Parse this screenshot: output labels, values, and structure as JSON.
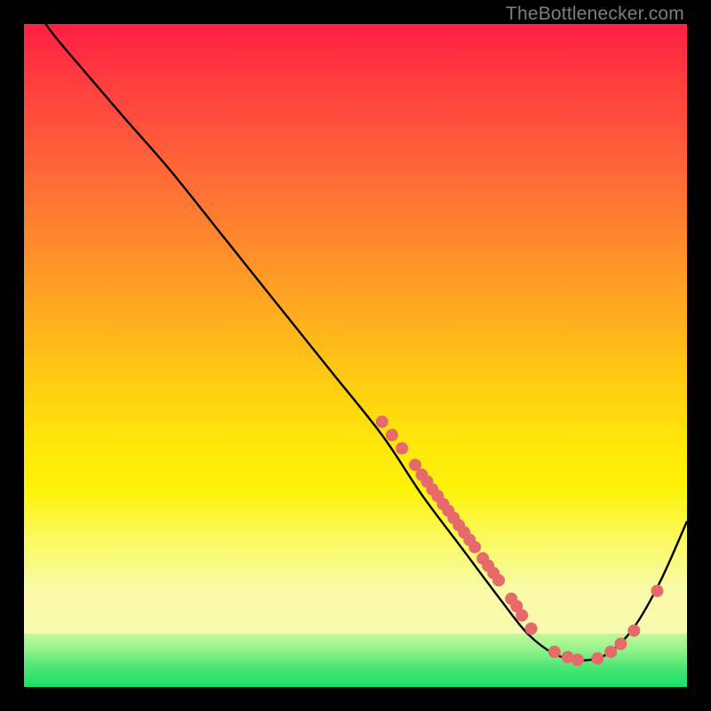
{
  "attribution": "TheBottlenecker.com",
  "chart_data": {
    "type": "line",
    "title": "",
    "xlabel": "",
    "ylabel": "",
    "xlim": [
      0,
      100
    ],
    "ylim": [
      0,
      100
    ],
    "grid": false,
    "series": [
      {
        "name": "curve",
        "x": [
          0,
          4,
          9,
          15,
          22,
          30,
          38,
          46,
          54,
          60,
          66,
          72,
          76,
          80,
          84,
          88,
          92,
          96,
          100
        ],
        "y": [
          105,
          99,
          93,
          86,
          78,
          68,
          58,
          48,
          38,
          29,
          21,
          13,
          8,
          5,
          4,
          5,
          9,
          16,
          25
        ]
      }
    ],
    "markers": [
      {
        "x": 54.0,
        "y": 40.0
      },
      {
        "x": 55.5,
        "y": 38.0
      },
      {
        "x": 57.0,
        "y": 36.0
      },
      {
        "x": 59.0,
        "y": 33.5
      },
      {
        "x": 60.0,
        "y": 32.0
      },
      {
        "x": 60.8,
        "y": 31.0
      },
      {
        "x": 61.6,
        "y": 29.8
      },
      {
        "x": 62.4,
        "y": 28.8
      },
      {
        "x": 63.2,
        "y": 27.6
      },
      {
        "x": 64.0,
        "y": 26.6
      },
      {
        "x": 64.8,
        "y": 25.5
      },
      {
        "x": 65.6,
        "y": 24.4
      },
      {
        "x": 66.4,
        "y": 23.3
      },
      {
        "x": 67.2,
        "y": 22.2
      },
      {
        "x": 68.0,
        "y": 21.1
      },
      {
        "x": 69.2,
        "y": 19.4
      },
      {
        "x": 70.0,
        "y": 18.3
      },
      {
        "x": 70.8,
        "y": 17.2
      },
      {
        "x": 71.6,
        "y": 16.1
      },
      {
        "x": 73.5,
        "y": 13.3
      },
      {
        "x": 74.3,
        "y": 12.2
      },
      {
        "x": 75.1,
        "y": 10.8
      },
      {
        "x": 76.5,
        "y": 8.8
      },
      {
        "x": 80.0,
        "y": 5.3
      },
      {
        "x": 82.0,
        "y": 4.5
      },
      {
        "x": 83.5,
        "y": 4.1
      },
      {
        "x": 86.5,
        "y": 4.3
      },
      {
        "x": 88.5,
        "y": 5.3
      },
      {
        "x": 90.0,
        "y": 6.5
      },
      {
        "x": 92.0,
        "y": 8.5
      },
      {
        "x": 95.5,
        "y": 14.5
      }
    ],
    "marker_style": {
      "color": "#e66a6a",
      "radius_px": 7
    }
  }
}
